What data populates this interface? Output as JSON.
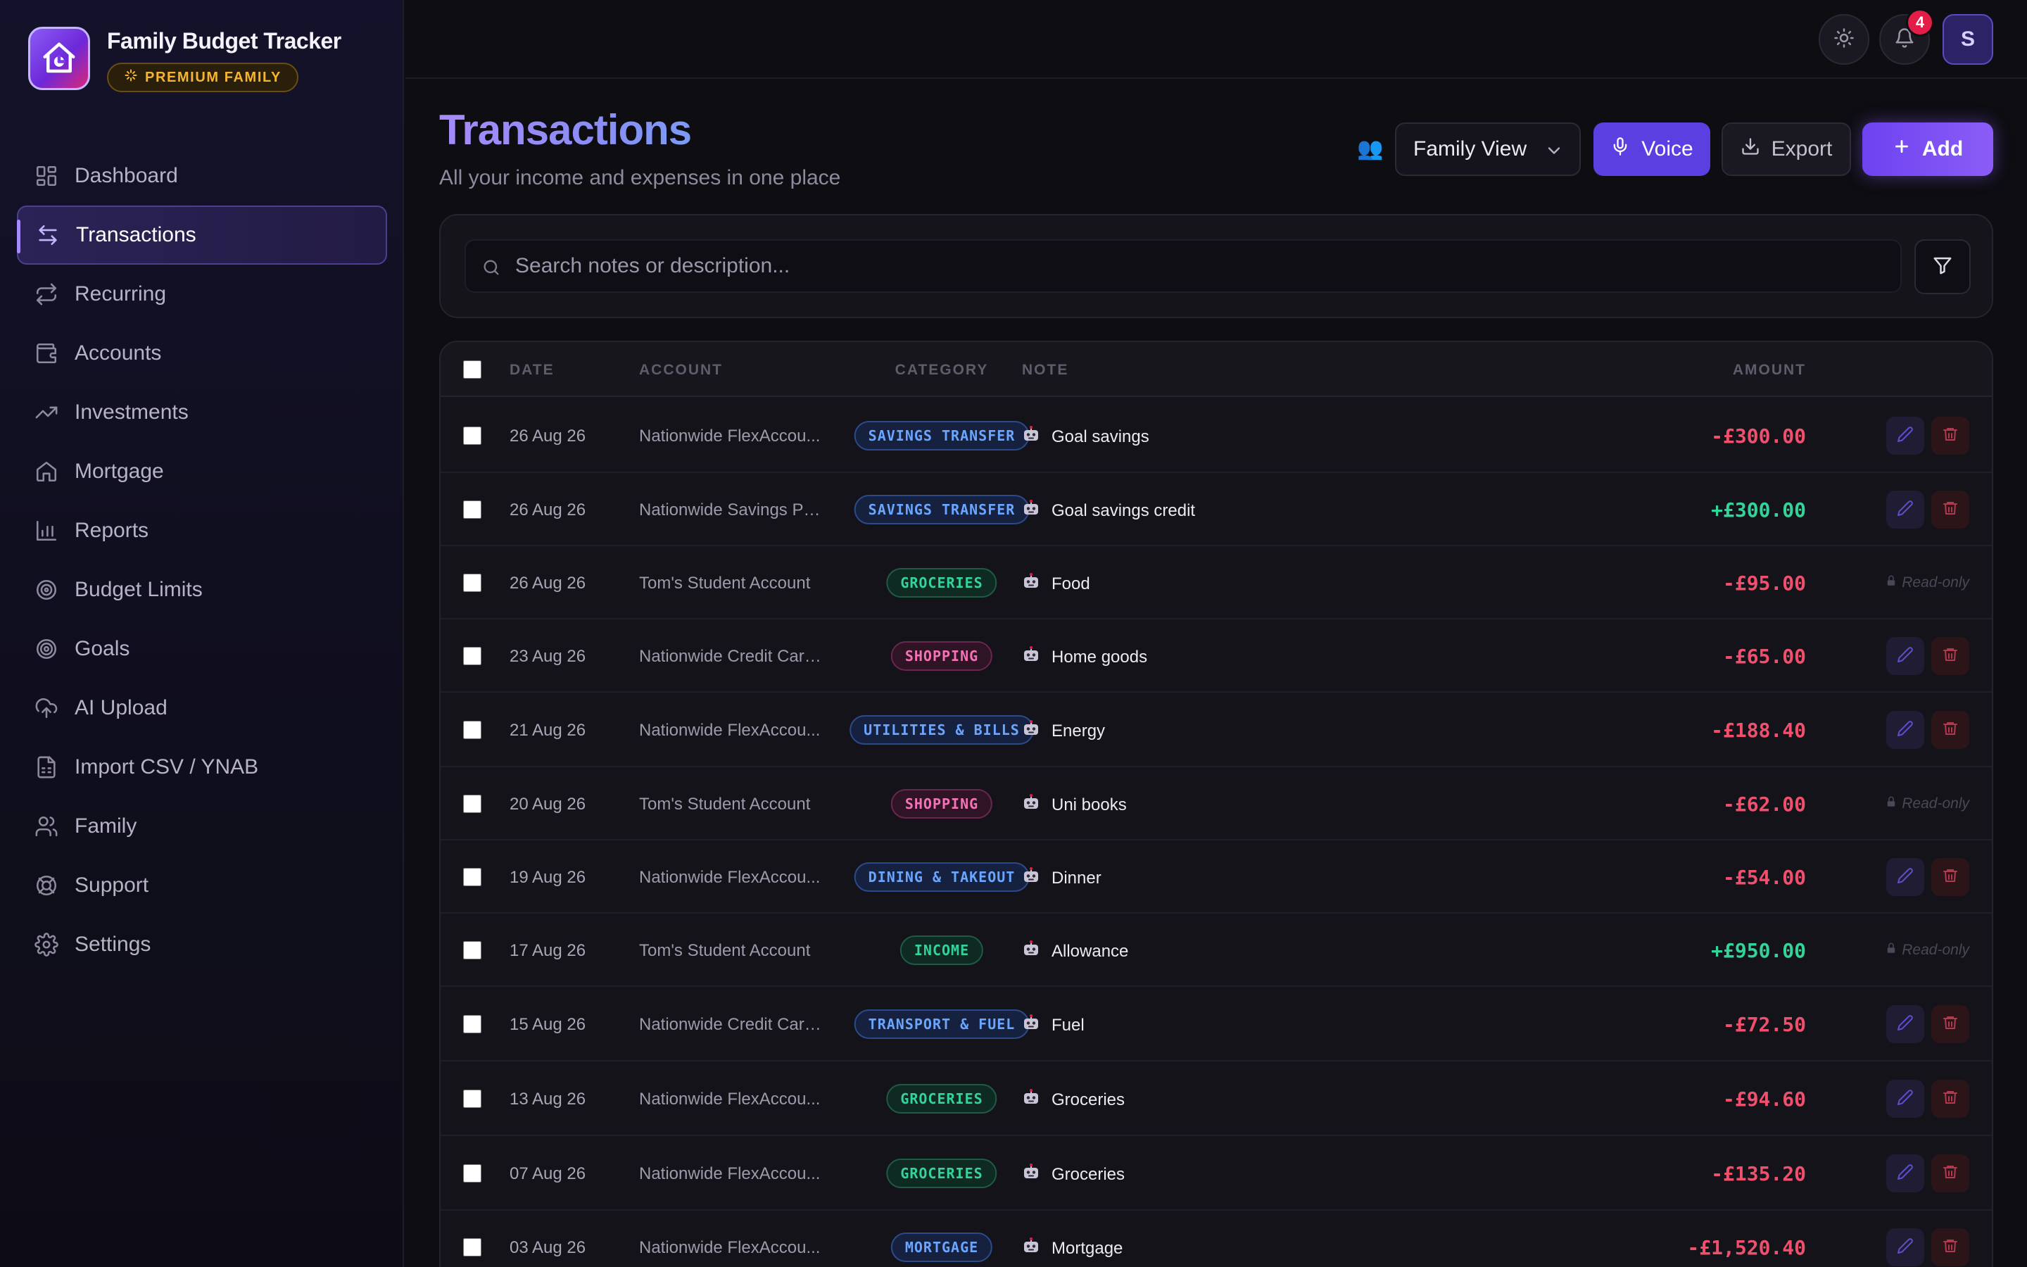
{
  "app": {
    "title": "Family Budget Tracker",
    "plan_badge": "PREMIUM FAMILY"
  },
  "sidebar": {
    "items": [
      {
        "label": "Dashboard",
        "icon": "dashboard-icon"
      },
      {
        "label": "Transactions",
        "icon": "arrows-swap-icon",
        "active": true
      },
      {
        "label": "Recurring",
        "icon": "repeat-icon"
      },
      {
        "label": "Accounts",
        "icon": "wallet-icon"
      },
      {
        "label": "Investments",
        "icon": "trending-up-icon"
      },
      {
        "label": "Mortgage",
        "icon": "home-icon"
      },
      {
        "label": "Reports",
        "icon": "bar-chart-icon"
      },
      {
        "label": "Budget Limits",
        "icon": "target-icon"
      },
      {
        "label": "Goals",
        "icon": "goal-icon"
      },
      {
        "label": "AI Upload",
        "icon": "cloud-upload-icon"
      },
      {
        "label": "Import CSV / YNAB",
        "icon": "file-spreadsheet-icon"
      },
      {
        "label": "Family",
        "icon": "users-icon"
      },
      {
        "label": "Support",
        "icon": "lifebuoy-icon"
      },
      {
        "label": "Settings",
        "icon": "gear-icon"
      }
    ]
  },
  "topbar": {
    "notifications_count": "4",
    "avatar_initial": "S"
  },
  "page": {
    "title": "Transactions",
    "subtitle": "All your income and expenses in one place",
    "view_emoji": "👥",
    "view_select": "Family View",
    "voice_label": "Voice",
    "export_label": "Export",
    "add_label": "Add"
  },
  "search": {
    "placeholder": "Search notes or description..."
  },
  "table": {
    "headers": {
      "date": "DATE",
      "account": "ACCOUNT",
      "category": "CATEGORY",
      "note": "NOTE",
      "amount": "AMOUNT"
    },
    "readonly_label": "Read-only",
    "rows": [
      {
        "date": "26 Aug 26",
        "account": "Nationwide FlexAccou...",
        "category": "SAVINGS TRANSFER",
        "note": "Goal savings",
        "amount": "-£300.00",
        "editable": true
      },
      {
        "date": "26 Aug 26",
        "account": "Nationwide Savings Po...",
        "category": "SAVINGS TRANSFER",
        "note": "Goal savings credit",
        "amount": "+£300.00",
        "editable": true
      },
      {
        "date": "26 Aug 26",
        "account": "Tom's Student Account",
        "category": "GROCERIES",
        "note": "Food",
        "amount": "-£95.00",
        "editable": false
      },
      {
        "date": "23 Aug 26",
        "account": "Nationwide Credit Card...",
        "category": "SHOPPING",
        "note": "Home goods",
        "amount": "-£65.00",
        "editable": true
      },
      {
        "date": "21 Aug 26",
        "account": "Nationwide FlexAccou...",
        "category": "UTILITIES & BILLS",
        "note": "Energy",
        "amount": "-£188.40",
        "editable": true
      },
      {
        "date": "20 Aug 26",
        "account": "Tom's Student Account",
        "category": "SHOPPING",
        "note": "Uni books",
        "amount": "-£62.00",
        "editable": false
      },
      {
        "date": "19 Aug 26",
        "account": "Nationwide FlexAccou...",
        "category": "DINING & TAKEOUT",
        "note": "Dinner",
        "amount": "-£54.00",
        "editable": true
      },
      {
        "date": "17 Aug 26",
        "account": "Tom's Student Account",
        "category": "INCOME",
        "note": "Allowance",
        "amount": "+£950.00",
        "editable": false
      },
      {
        "date": "15 Aug 26",
        "account": "Nationwide Credit Card...",
        "category": "TRANSPORT & FUEL",
        "note": "Fuel",
        "amount": "-£72.50",
        "editable": true
      },
      {
        "date": "13 Aug 26",
        "account": "Nationwide FlexAccou...",
        "category": "GROCERIES",
        "note": "Groceries",
        "amount": "-£94.60",
        "editable": true
      },
      {
        "date": "07 Aug 26",
        "account": "Nationwide FlexAccou...",
        "category": "GROCERIES",
        "note": "Groceries",
        "amount": "-£135.20",
        "editable": true
      },
      {
        "date": "03 Aug 26",
        "account": "Nationwide FlexAccou...",
        "category": "MORTGAGE",
        "note": "Mortgage",
        "amount": "-£1,520.40",
        "editable": true
      }
    ]
  },
  "colors": {
    "accent": "#8b5cf6",
    "negative": "#f0506e",
    "positive": "#34d399",
    "badge_blue_text": "#6aa6ff",
    "badge_green_text": "#34d399",
    "badge_pink_text": "#f472b6"
  }
}
